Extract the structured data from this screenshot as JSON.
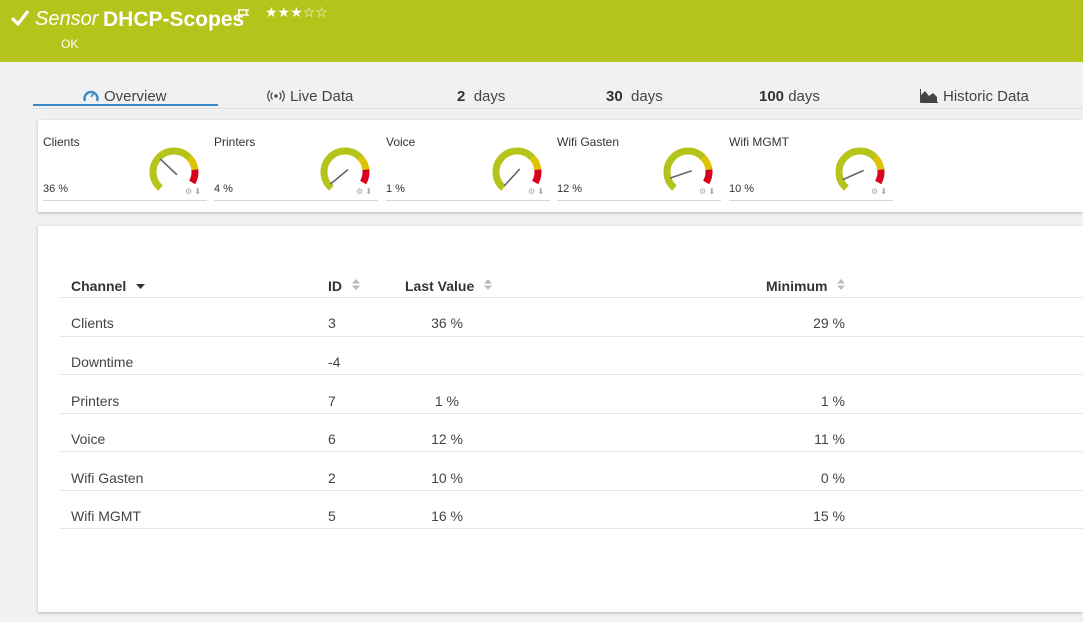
{
  "header": {
    "sensor_label": "Sensor",
    "sensor_name": "DHCP-Scopes",
    "stars": "★★★☆☆",
    "status": "OK",
    "check_icon": "check-icon",
    "flag_icon": "flag-icon",
    "bg_color": "#b5c41a"
  },
  "tabs": {
    "overview": "Overview",
    "live_data": "Live Data",
    "two_days_num": "2",
    "two_days_unit": "days",
    "thirty_days_num": "30",
    "thirty_days_unit": "days",
    "hundred_days_num": "100",
    "hundred_days_unit": "days",
    "historic": "Historic Data"
  },
  "gauges": [
    {
      "name": "Clients",
      "value": "36 %",
      "percent": 36
    },
    {
      "name": "Printers",
      "value": "4 %",
      "percent": 4
    },
    {
      "name": "Voice",
      "value": "1 %",
      "percent": 1
    },
    {
      "name": "Wifi Gasten",
      "value": "12 %",
      "percent": 12
    },
    {
      "name": "Wifi MGMT",
      "value": "10 %",
      "percent": 10
    }
  ],
  "table": {
    "headers": {
      "channel": "Channel",
      "id": "ID",
      "last_value": "Last Value",
      "minimum": "Minimum"
    },
    "rows": [
      {
        "channel": "Clients",
        "id": "3",
        "last": "36 %",
        "min": "29 %"
      },
      {
        "channel": "Downtime",
        "id": "-4",
        "last": "",
        "min": ""
      },
      {
        "channel": "Printers",
        "id": "7",
        "last": "1 %",
        "min": "1 %"
      },
      {
        "channel": "Voice",
        "id": "6",
        "last": "12 %",
        "min": "11 %"
      },
      {
        "channel": "Wifi Gasten",
        "id": "2",
        "last": "10 %",
        "min": "0 %"
      },
      {
        "channel": "Wifi MGMT",
        "id": "5",
        "last": "16 %",
        "min": "15 %"
      }
    ]
  },
  "colors": {
    "accent": "#3b8ac4",
    "gauge_green": "#b5c41a",
    "gauge_yellow": "#e0c300",
    "gauge_red": "#d9001b"
  }
}
